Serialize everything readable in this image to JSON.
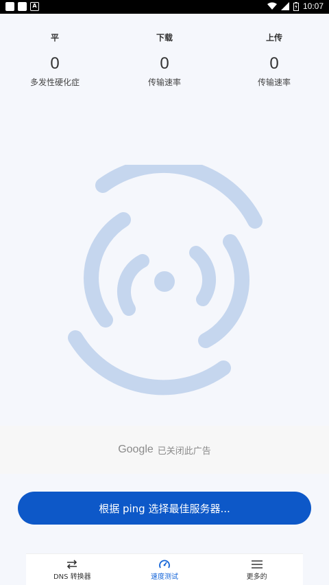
{
  "status_bar": {
    "time": "10:07"
  },
  "stats": [
    {
      "title": "平",
      "value": "0",
      "subtitle": "多发性硬化症"
    },
    {
      "title": "下载",
      "value": "0",
      "subtitle": "传输速率"
    },
    {
      "title": "上传",
      "value": "0",
      "subtitle": "传输速率"
    }
  ],
  "ad": {
    "brand": "Google",
    "text": "已关闭此广告"
  },
  "cta": {
    "label": "根据 ping 选择最佳服务器..."
  },
  "nav": {
    "items": [
      {
        "label": "DNS 转换器",
        "icon": "swap-icon",
        "active": false
      },
      {
        "label": "速度测试",
        "icon": "speedometer-icon",
        "active": true
      },
      {
        "label": "更多的",
        "icon": "menu-icon",
        "active": false
      }
    ]
  },
  "colors": {
    "accent": "#0d58c8",
    "active_nav": "#1565d8",
    "graphic": "#c5d6ee"
  }
}
